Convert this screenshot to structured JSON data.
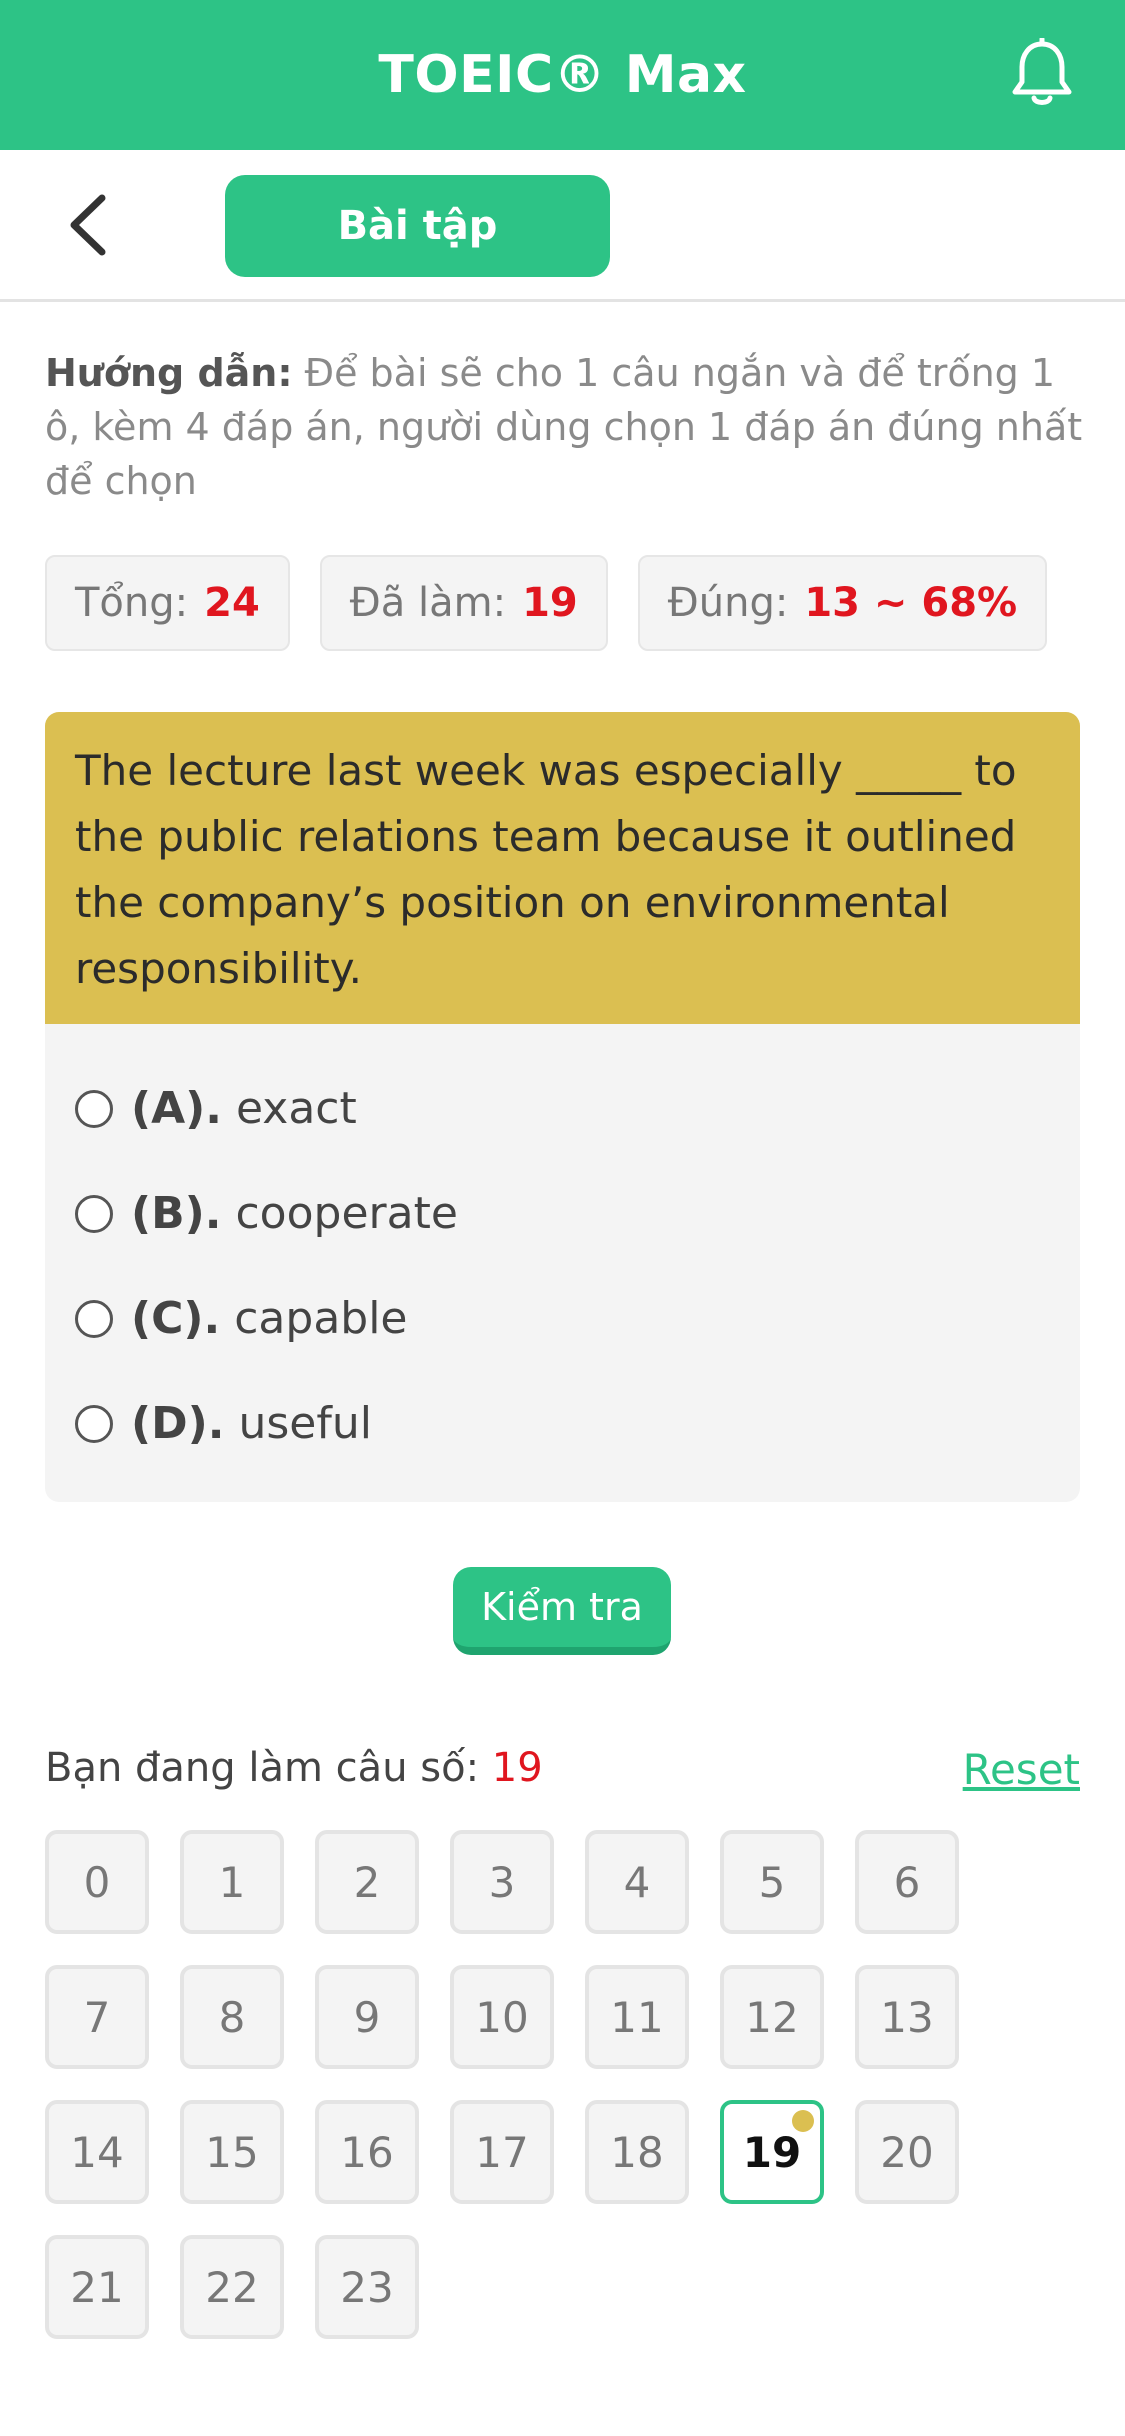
{
  "header": {
    "title": "TOEIC® Max",
    "bell_icon": "bell-icon"
  },
  "nav": {
    "back_icon": "chevron-left-icon",
    "tab_label": "Bài tập"
  },
  "instruction": {
    "label": "Hướng dẫn:",
    "text": " Để bài sẽ cho 1 câu ngắn và để trống 1 ô, kèm 4 đáp án, người dùng chọn 1 đáp án đúng nhất để chọn"
  },
  "stats": {
    "total_label": "Tổng:",
    "total_value": "24",
    "done_label": "Đã làm:",
    "done_value": "19",
    "correct_label": "Đúng:",
    "correct_value": "13 ~ 68%"
  },
  "question": {
    "text": "The lecture last week was especially _____ to the public relations team because it outlined the company’s position on environmental responsibility.",
    "options": [
      {
        "label": "(A).",
        "text": "exact"
      },
      {
        "label": "(B).",
        "text": "cooperate"
      },
      {
        "label": "(C).",
        "text": "capable"
      },
      {
        "label": "(D).",
        "text": "useful"
      }
    ]
  },
  "check_button": "Kiểm tra",
  "progress": {
    "label": "Bạn đang làm câu số:",
    "current": "19",
    "reset": "Reset",
    "numbers": [
      "0",
      "1",
      "2",
      "3",
      "4",
      "5",
      "6",
      "7",
      "8",
      "9",
      "10",
      "11",
      "12",
      "13",
      "14",
      "15",
      "16",
      "17",
      "18",
      "19",
      "20",
      "21",
      "22",
      "23"
    ],
    "active_index": 19
  },
  "colors": {
    "primary": "#2dc386",
    "question_bg": "#dbbf51",
    "highlight": "#e0161f"
  }
}
